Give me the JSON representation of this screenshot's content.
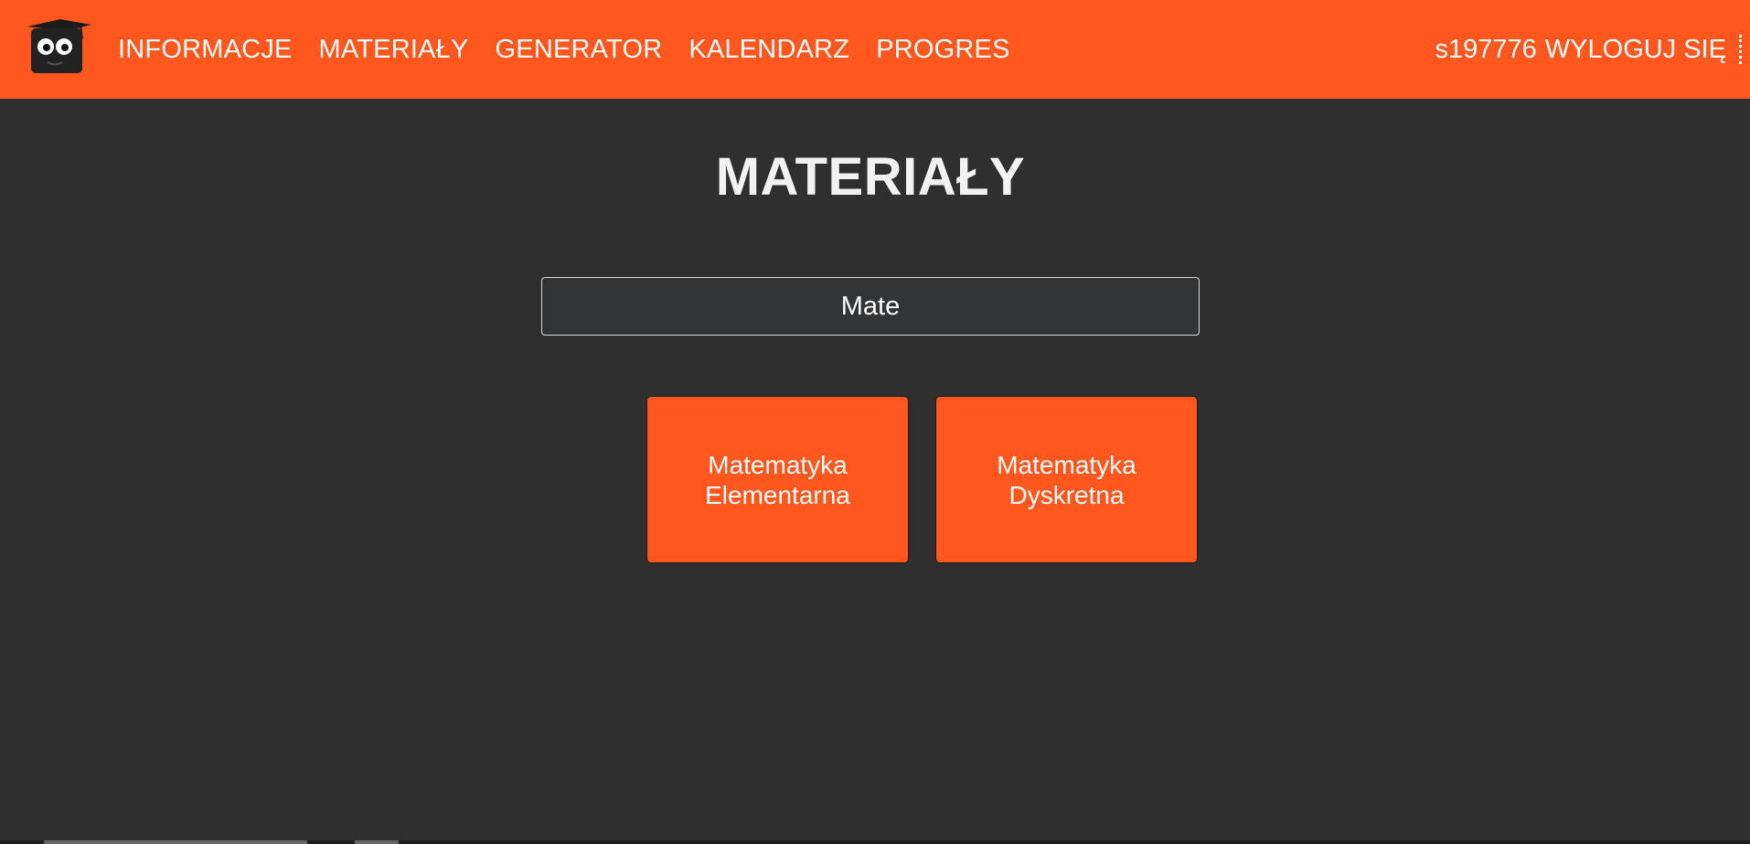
{
  "colors": {
    "accent": "#ff571d",
    "background": "#2f2f2f",
    "text": "#ffffff"
  },
  "header": {
    "logo_icon": "owl-graduation-cap-icon",
    "nav": [
      {
        "label": "INFORMACJE"
      },
      {
        "label": "MATERIAŁY"
      },
      {
        "label": "GENERATOR"
      },
      {
        "label": "KALENDARZ"
      },
      {
        "label": "PROGRES"
      }
    ],
    "username": "s197776",
    "logout_label": "WYLOGUJ SIĘ"
  },
  "main": {
    "title": "MATERIAŁY",
    "search": {
      "value": "Mate"
    },
    "cards": [
      {
        "label": "Matematyka Elementarna"
      },
      {
        "label": "Matematyka Dyskretna"
      }
    ]
  }
}
